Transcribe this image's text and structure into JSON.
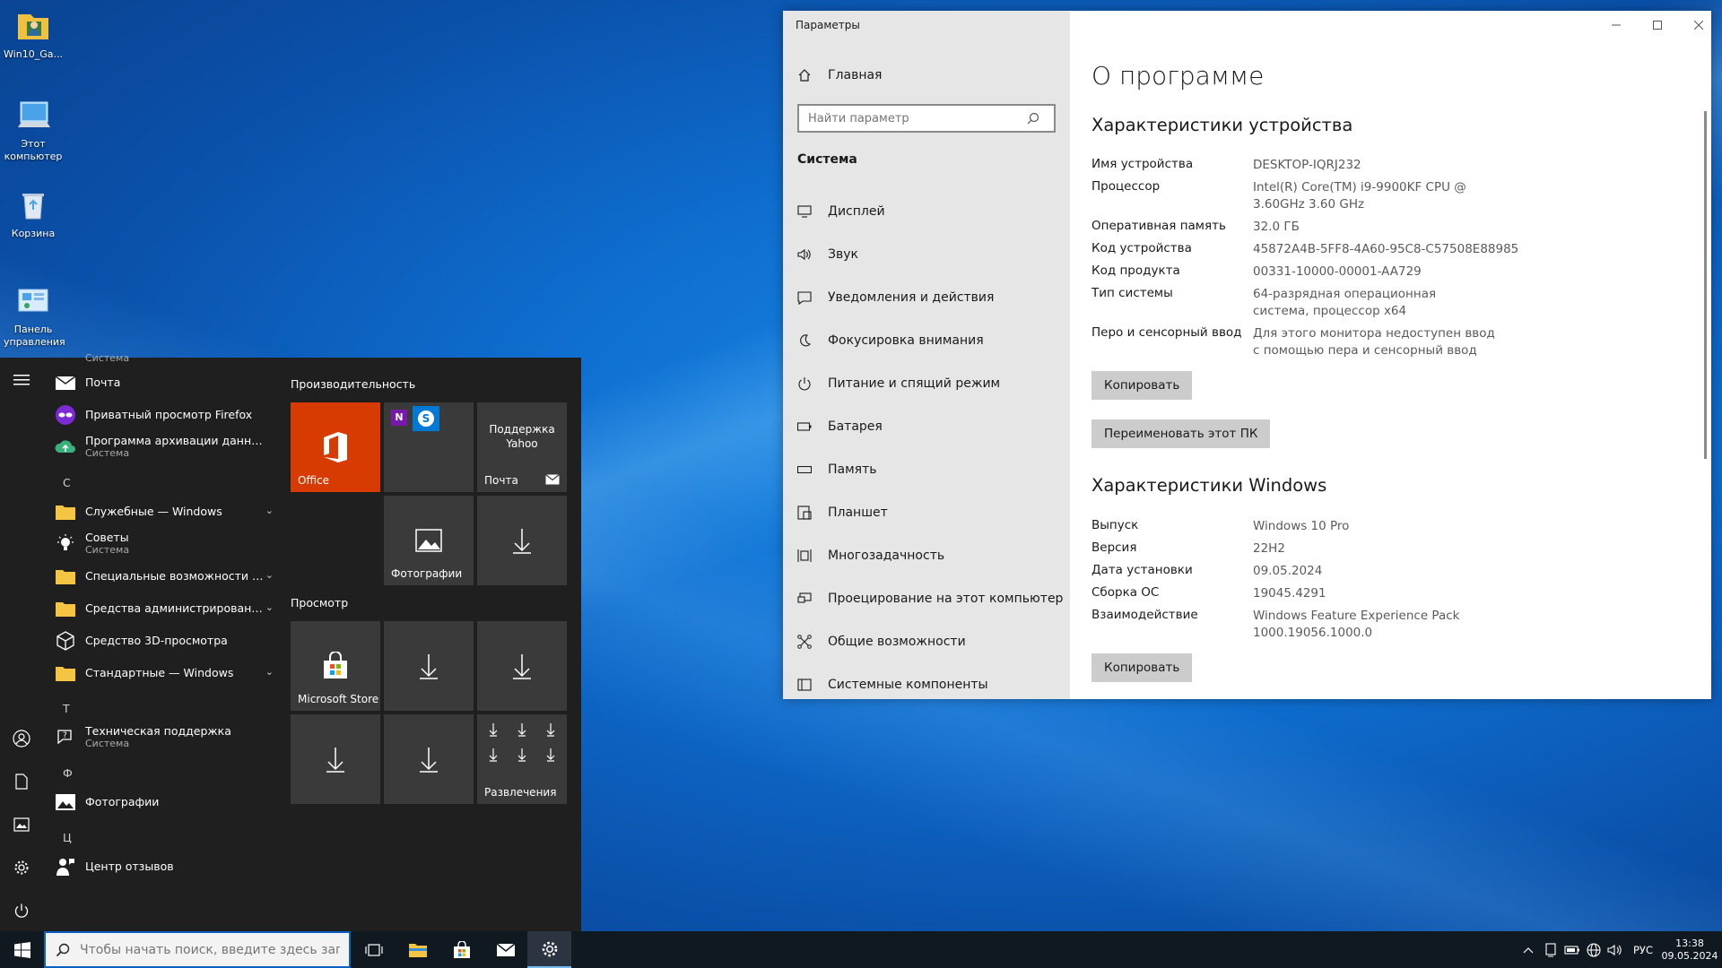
{
  "desktop": {
    "icons": [
      {
        "label": "Win10_Ga..."
      },
      {
        "label": "Этот компьютер"
      },
      {
        "label": "Корзина"
      },
      {
        "label": "Панель управления"
      }
    ]
  },
  "start_menu": {
    "top_partial_sub": "Система",
    "apps": [
      {
        "name": "Почта",
        "sub": ""
      },
      {
        "name": "Приватный просмотр Firefox",
        "sub": ""
      },
      {
        "name": "Программа архивации данных",
        "sub": "Система"
      },
      {
        "name": "Служебные — Windows",
        "sub": ""
      },
      {
        "name": "Советы",
        "sub": "Система"
      },
      {
        "name": "Специальные возможности Win...",
        "sub": ""
      },
      {
        "name": "Средства администрирования W...",
        "sub": ""
      },
      {
        "name": "Средство 3D-просмотра",
        "sub": ""
      },
      {
        "name": "Стандартные — Windows",
        "sub": ""
      },
      {
        "name": "Техническая поддержка",
        "sub": "Система"
      },
      {
        "name": "Фотографии",
        "sub": ""
      },
      {
        "name": "Центр отзывов",
        "sub": ""
      }
    ],
    "letters": [
      "С",
      "Т",
      "Ф",
      "Ц"
    ],
    "groups": [
      "Производительность",
      "Просмотр"
    ],
    "tiles": {
      "office": "Office",
      "yahoo": "Поддержка Yahoo",
      "mail": "Почта",
      "photos": "Фотографии",
      "store": "Microsoft Store",
      "entertainment": "Развлечения"
    }
  },
  "settings": {
    "window_title": "Параметры",
    "home": "Главная",
    "search_placeholder": "Найти параметр",
    "section": "Система",
    "nav": [
      "Дисплей",
      "Звук",
      "Уведомления и действия",
      "Фокусировка внимания",
      "Питание и спящий режим",
      "Батарея",
      "Память",
      "Планшет",
      "Многозадачность",
      "Проецирование на этот компьютер",
      "Общие возможности",
      "Системные компоненты"
    ],
    "page_title": "О программе",
    "device_heading": "Характеристики устройства",
    "device_specs": [
      {
        "label": "Имя устройства",
        "value": "DESKTOP-IQRJ232"
      },
      {
        "label": "Процессор",
        "value": "Intel(R) Core(TM) i9-9900KF CPU @ 3.60GHz   3.60 GHz"
      },
      {
        "label": "Оперативная память",
        "value": "32.0 ГБ"
      },
      {
        "label": "Код устройства",
        "value": "45872A4B-5FF8-4A60-95C8-C57508E88985"
      },
      {
        "label": "Код продукта",
        "value": "00331-10000-00001-AA729"
      },
      {
        "label": "Тип системы",
        "value": "64-разрядная операционная система, процессор x64"
      },
      {
        "label": "Перо и сенсорный ввод",
        "value": "Для этого монитора недоступен ввод с помощью пера и сенсорный ввод"
      }
    ],
    "copy_button": "Копировать",
    "rename_button": "Переименовать этот ПК",
    "windows_heading": "Характеристики Windows",
    "windows_specs": [
      {
        "label": "Выпуск",
        "value": "Windows 10 Pro"
      },
      {
        "label": "Версия",
        "value": "22H2"
      },
      {
        "label": "Дата установки",
        "value": "09.05.2024"
      },
      {
        "label": "Сборка ОС",
        "value": "19045.4291"
      },
      {
        "label": "Взаимодействие",
        "value": "Windows Feature Experience Pack 1000.19056.1000.0"
      }
    ],
    "copy_button_2": "Копировать"
  },
  "taskbar": {
    "search_placeholder": "Чтобы начать поиск, введите здесь запрос",
    "language": "РУС",
    "time": "13:38",
    "date": "09.05.2024"
  },
  "colors": {
    "accent": "#0a63c2",
    "office_tile": "#d83b01",
    "start_bg": "#1f1f1f",
    "tile_bg": "#3a3a3a",
    "sidebar_bg": "#e6e6e6"
  }
}
